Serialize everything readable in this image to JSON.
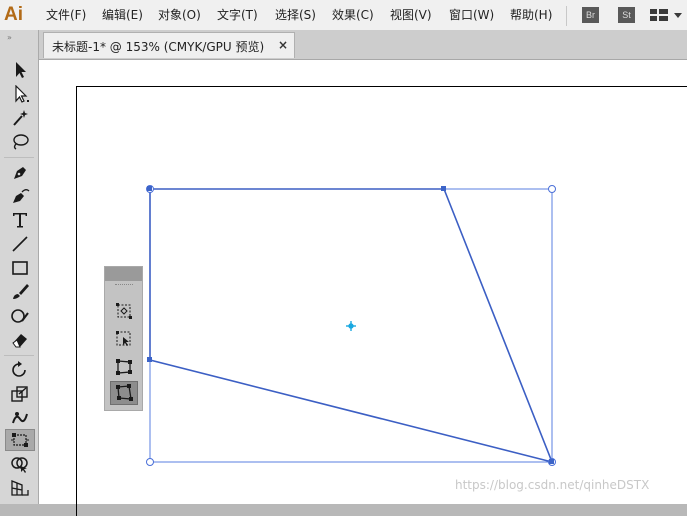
{
  "app": {
    "logo": "Ai"
  },
  "menus": [
    {
      "label": "文件(F)"
    },
    {
      "label": "编辑(E)"
    },
    {
      "label": "对象(O)"
    },
    {
      "label": "文字(T)"
    },
    {
      "label": "选择(S)"
    },
    {
      "label": "效果(C)"
    },
    {
      "label": "视图(V)"
    },
    {
      "label": "窗口(W)"
    },
    {
      "label": "帮助(H)"
    }
  ],
  "app_buttons": [
    {
      "label": "Br"
    },
    {
      "label": "St"
    }
  ],
  "toolbar": {
    "grip": "»",
    "tools": [
      {
        "icon": "selection-arrow-icon"
      },
      {
        "icon": "direct-selection-icon"
      },
      {
        "icon": "magic-wand-icon"
      },
      {
        "icon": "lasso-icon"
      },
      {
        "icon": "pen-icon"
      },
      {
        "icon": "curvature-icon"
      },
      {
        "icon": "type-icon"
      },
      {
        "icon": "line-segment-icon"
      },
      {
        "icon": "rectangle-icon"
      },
      {
        "icon": "paintbrush-icon"
      },
      {
        "icon": "shaper-icon"
      },
      {
        "icon": "eraser-icon"
      },
      {
        "icon": "rotate-icon"
      },
      {
        "icon": "scale-icon"
      },
      {
        "icon": "warp-icon"
      },
      {
        "icon": "free-transform-icon"
      },
      {
        "icon": "shape-builder-icon"
      },
      {
        "icon": "perspective-grid-icon"
      }
    ],
    "active_index": 15
  },
  "document_tab": {
    "title": "未标题-1* @ 153% (CMYK/GPU 预览)",
    "close": "×"
  },
  "flyout": {
    "tools": [
      {
        "icon": "constrain-icon"
      },
      {
        "icon": "free-transform-icon"
      },
      {
        "icon": "perspective-distort-icon"
      },
      {
        "icon": "free-distort-icon"
      }
    ],
    "active_index": 3
  },
  "colors": {
    "selection": "#3c64c8",
    "center_point": "#19a8e0",
    "ai_brand": "#b26a16"
  },
  "watermark": "https://blog.csdn.net/qinheDSTX"
}
